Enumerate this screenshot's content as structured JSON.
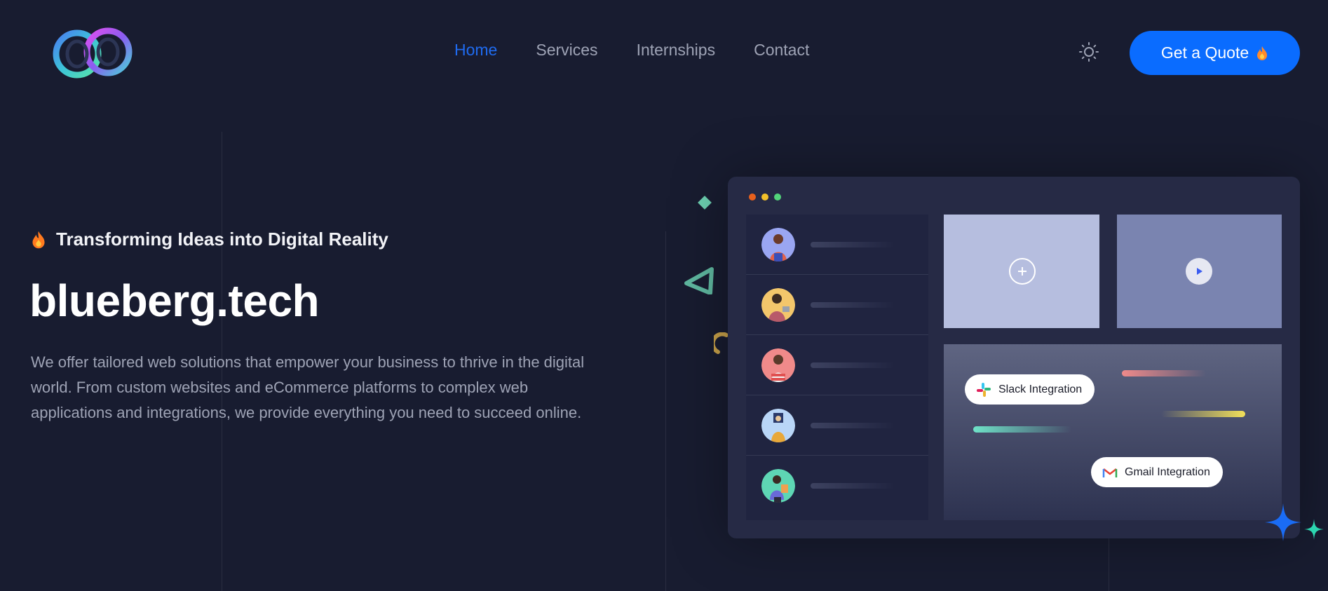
{
  "header": {
    "logo_alt": "blueberg.tech logo",
    "nav": [
      {
        "label": "Home",
        "active": true
      },
      {
        "label": "Services",
        "active": false
      },
      {
        "label": "Internships",
        "active": false
      },
      {
        "label": "Contact",
        "active": false
      }
    ],
    "theme_toggle_icon": "sun-icon",
    "cta_label": "Get a Quote",
    "cta_icon": "fire-icon"
  },
  "hero": {
    "tagline_icon": "fire-icon",
    "tagline": "Transforming Ideas into Digital Reality",
    "title": "blueberg.tech",
    "description": "We offer tailored web solutions that empower your business to thrive in the digital world. From custom websites and eCommerce platforms to complex web applications and integrations, we provide everything you need to succeed online."
  },
  "mockup": {
    "window_dot_colors": [
      "#e8601c",
      "#f2c02a",
      "#52d47a"
    ],
    "list_avatar_colors": [
      "#9aa6f2",
      "#f3c66b",
      "#f08a8a",
      "#b9d6f7",
      "#5ed6b4"
    ],
    "add_icon": "plus-icon",
    "play_icon": "play-icon",
    "slack_chip": "Slack Integration",
    "gmail_chip": "Gmail Integration"
  },
  "colors": {
    "background": "#181c30",
    "accent": "#0a6cff",
    "nav_active": "#1f6bf0",
    "muted_text": "#9ea3b5"
  }
}
